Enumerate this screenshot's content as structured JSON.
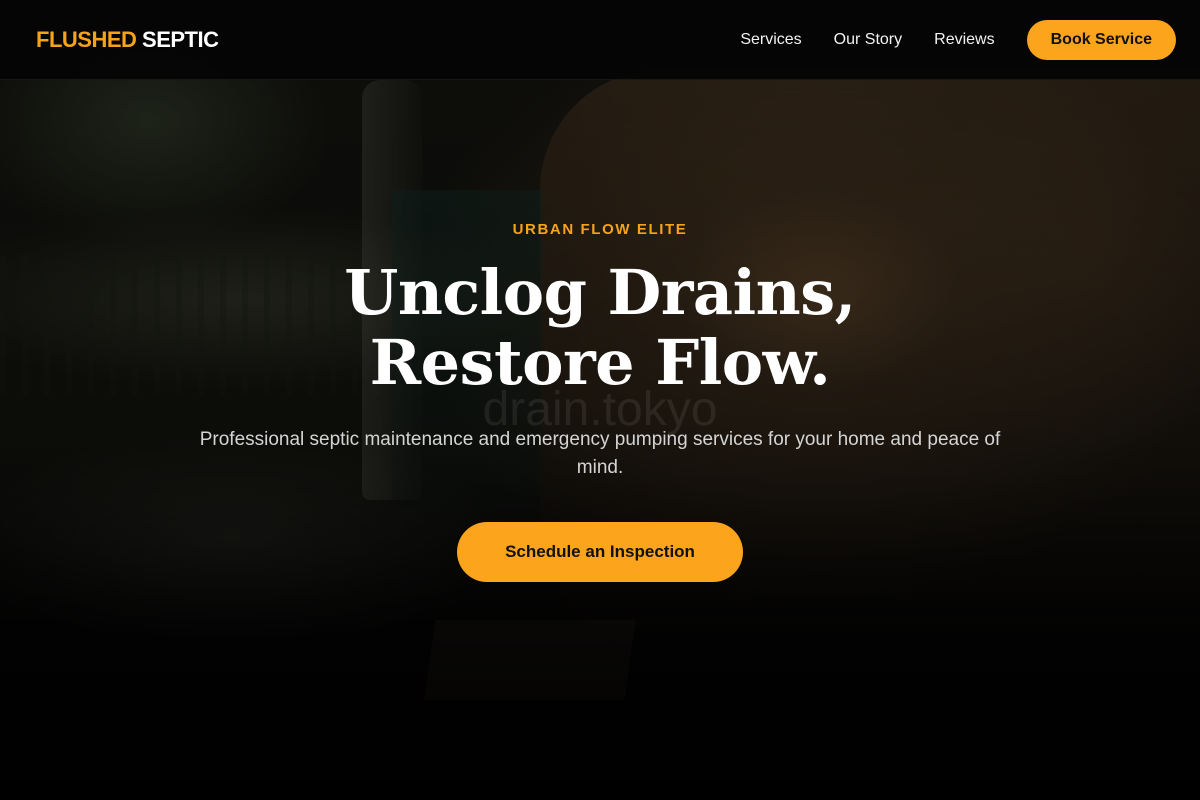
{
  "header": {
    "logo": {
      "accent_text": "FLUSHED",
      "rest_text": "SEPTIC"
    },
    "nav": {
      "items": [
        {
          "label": "Services"
        },
        {
          "label": "Our Story"
        },
        {
          "label": "Reviews"
        }
      ],
      "cta_label": "Book Service"
    }
  },
  "hero": {
    "eyebrow": "URBAN FLOW ELITE",
    "headline_line1": "Unclog Drains,",
    "headline_line2": "Restore Flow.",
    "watermark": "drain.tokyo",
    "subtext": "Professional septic maintenance and emergency pumping services for your home and peace of mind.",
    "cta_label": "Schedule an Inspection"
  },
  "colors": {
    "accent": "#fba41c",
    "eyebrow": "#f5a319",
    "header_bg": "#050505",
    "headline": "#ffffff"
  }
}
